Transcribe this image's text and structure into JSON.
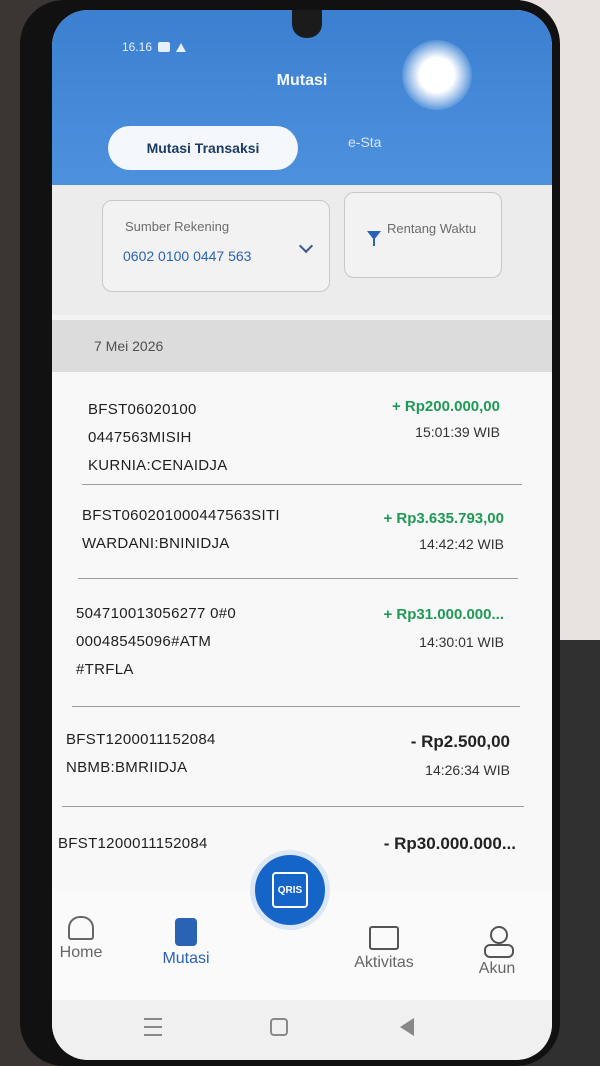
{
  "status_bar": {
    "time": "16.16"
  },
  "header": {
    "title": "Mutasi",
    "tab_active": "Mutasi Transaksi",
    "tab_other": "e-Sta"
  },
  "filters": {
    "source_label": "Sumber Rekening",
    "source_value": "0602 0100 0447 563",
    "range_label": "Rentang Waktu"
  },
  "date_group": "7 Mei 2026",
  "transactions": [
    {
      "desc": "BFST06020100 0447563MISIH KURNIA:CENAIDJA",
      "amount": "+ Rp200.000,00",
      "time": "15:01:39 WIB"
    },
    {
      "desc": "BFST060201000447563SITI WARDANI:BNINIDJA",
      "amount": "+ Rp3.635.793,00",
      "time": "14:42:42 WIB"
    },
    {
      "desc": "504710013056277 0#0 00048545096#ATM #TRFLA",
      "amount": "+ Rp31.000.000...",
      "time": "14:30:01 WIB"
    },
    {
      "desc": "BFST1200011152084 NBMB:BMRIIDJA",
      "amount": "- Rp2.500,00",
      "time": "14:26:34 WIB"
    },
    {
      "desc": "BFST1200011152084",
      "amount": "- Rp30.000.000...",
      "time": ""
    }
  ],
  "nav": {
    "home": "Home",
    "mutasi": "Mutasi",
    "qris": "QRIS",
    "aktivitas": "Aktivitas",
    "akun": "Akun"
  },
  "icons": [
    "home-icon",
    "mutasi-icon",
    "qris-icon",
    "mail-icon",
    "user-icon",
    "filter-icon",
    "chevron-down-icon"
  ],
  "colors": {
    "header_blue": "#3b7fd0",
    "credit_green": "#1f9a55",
    "accent_blue": "#2a63b4"
  }
}
